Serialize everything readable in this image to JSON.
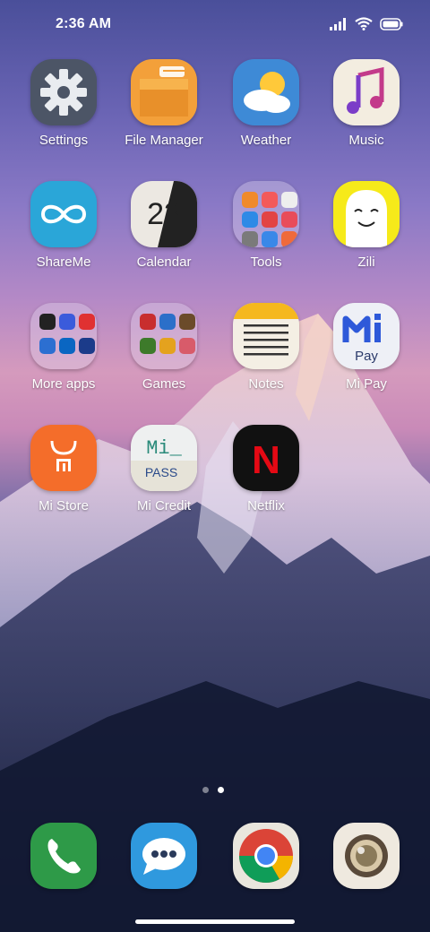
{
  "status": {
    "time": "2:36 AM",
    "icons": [
      "signal-icon",
      "wifi-icon",
      "battery-icon"
    ]
  },
  "apps": [
    {
      "label": "Settings",
      "icon": "gear-icon"
    },
    {
      "label": "File Manager",
      "icon": "folder-icon"
    },
    {
      "label": "Weather",
      "icon": "cloud-sun-icon"
    },
    {
      "label": "Music",
      "icon": "music-note-icon"
    },
    {
      "label": "ShareMe",
      "icon": "infinity-icon"
    },
    {
      "label": "Calendar",
      "icon": "calendar-icon",
      "date": "23"
    },
    {
      "label": "Tools",
      "icon": "tools-folder-icon"
    },
    {
      "label": "Zili",
      "icon": "ghost-face-icon"
    },
    {
      "label": "More apps",
      "icon": "apps-folder-icon"
    },
    {
      "label": "Games",
      "icon": "games-folder-icon"
    },
    {
      "label": "Notes",
      "icon": "notepad-icon"
    },
    {
      "label": "Mi Pay",
      "icon": "mi-pay-icon",
      "logo_text": "Pay"
    },
    {
      "label": "Mi Store",
      "icon": "mi-store-bag-icon"
    },
    {
      "label": "Mi Credit",
      "icon": "mi-credit-icon",
      "logo_top": "Mi_",
      "logo_bottom": "PASS"
    },
    {
      "label": "Netflix",
      "icon": "netflix-icon",
      "logo_text": "N"
    }
  ],
  "dock": [
    {
      "icon": "phone-icon"
    },
    {
      "icon": "messages-icon"
    },
    {
      "icon": "chrome-icon"
    },
    {
      "icon": "camera-icon"
    }
  ],
  "page_indicator": {
    "pages": 2,
    "current": 2
  }
}
